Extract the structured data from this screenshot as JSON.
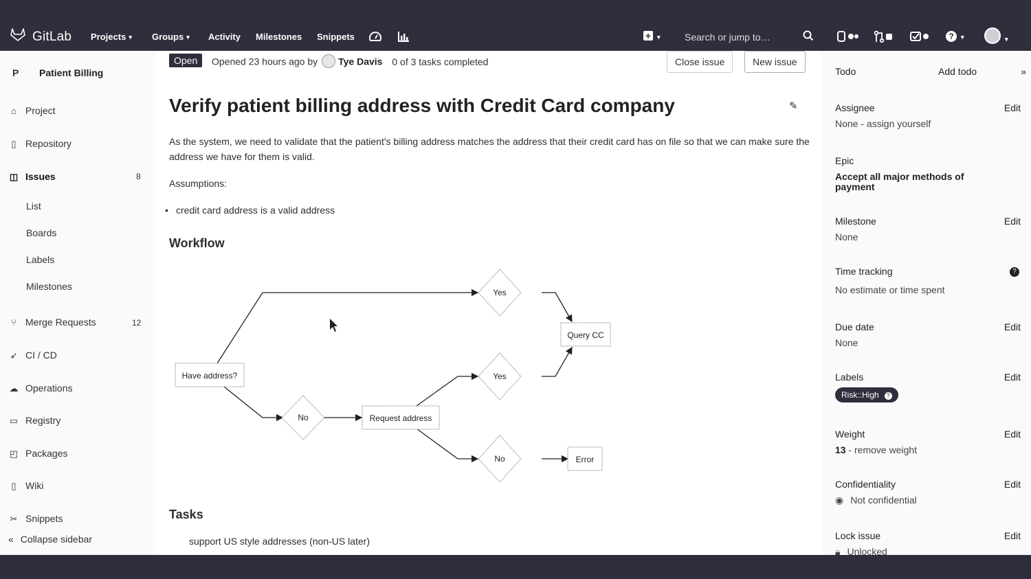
{
  "app": {
    "brand": "GitLab",
    "nav": [
      {
        "label": "Projects",
        "dropdown": true
      },
      {
        "label": "Groups",
        "dropdown": true
      },
      {
        "label": "Activity",
        "dropdown": false
      },
      {
        "label": "Milestones",
        "dropdown": false
      },
      {
        "label": "Snippets",
        "dropdown": false
      }
    ],
    "search_placeholder": "Search or jump to…",
    "top_icons": [
      "dashboard-icon",
      "chart-icon",
      "plus-icon",
      "search-icon",
      "issues-icon",
      "merge-request-icon",
      "todo-icon",
      "help-icon",
      "avatar"
    ]
  },
  "sidebar": {
    "project_initial": "P",
    "project_name": "Patient Billing",
    "items": [
      {
        "label": "Project",
        "icon": "home-icon",
        "count": ""
      },
      {
        "label": "Repository",
        "icon": "doc-icon",
        "count": ""
      },
      {
        "label": "Issues",
        "icon": "issues-icon",
        "count": "8"
      },
      {
        "label": "Merge Requests",
        "icon": "merge-request-icon",
        "count": "12"
      },
      {
        "label": "CI / CD",
        "icon": "rocket-icon",
        "count": ""
      },
      {
        "label": "Operations",
        "icon": "cloud-gear-icon",
        "count": ""
      },
      {
        "label": "Registry",
        "icon": "registry-icon",
        "count": ""
      },
      {
        "label": "Packages",
        "icon": "package-icon",
        "count": ""
      },
      {
        "label": "Wiki",
        "icon": "book-icon",
        "count": ""
      },
      {
        "label": "Snippets",
        "icon": "scissors-icon",
        "count": ""
      }
    ],
    "issue_subitems": [
      "List",
      "Boards",
      "Labels",
      "Milestones"
    ],
    "collapse_label": "Collapse sidebar"
  },
  "issue": {
    "status": "Open",
    "opened_text": "Opened 23 hours ago by",
    "author": "Tye Davis",
    "tasks_text": "0 of 3 tasks completed",
    "close_button": "Close issue",
    "new_button": "New issue",
    "title": "Verify patient billing address with Credit Card company",
    "description": "As the system, we need to validate that the patient's billing address matches the address that their credit card has on file so that we can make sure the address we have for them is valid.",
    "assumptions_label": "Assumptions:",
    "assumptions": [
      "credit card address is a valid address"
    ],
    "workflow_heading": "Workflow",
    "workflow": {
      "nodes": {
        "have_address": "Have address?",
        "yes_top": "Yes",
        "query_cc": "Query CC",
        "no_left": "No",
        "request_address": "Request address",
        "yes_mid": "Yes",
        "no_right": "No",
        "error": "Error"
      }
    },
    "tasks_heading": "Tasks",
    "tasks": [
      "support US style addresses (non-US later)"
    ]
  },
  "right_sidebar": {
    "todo_label": "Todo",
    "add_todo": "Add todo",
    "expand_icon": "»",
    "edit_label": "Edit",
    "assignee": {
      "label": "Assignee",
      "value": "None - assign yourself"
    },
    "epic": {
      "label": "Epic",
      "value": "Accept all major methods of payment"
    },
    "milestone": {
      "label": "Milestone",
      "value": "None"
    },
    "time_tracking": {
      "label": "Time tracking",
      "value": "No estimate or time spent"
    },
    "due_date": {
      "label": "Due date",
      "value": "None"
    },
    "labels": {
      "label": "Labels",
      "pill": "Risk::High",
      "pill_color": "#2f2e3c"
    },
    "weight": {
      "label": "Weight",
      "value": "13",
      "remove": " - remove weight"
    },
    "confidentiality": {
      "label": "Confidentiality",
      "value": "Not confidential"
    },
    "lock": {
      "label": "Lock issue",
      "value": "Unlocked"
    }
  }
}
